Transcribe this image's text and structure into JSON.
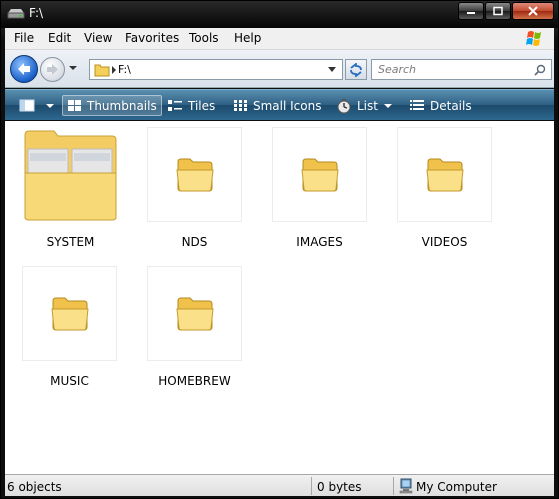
{
  "window": {
    "title": "F:\\"
  },
  "menu": {
    "items": [
      "File",
      "Edit",
      "View",
      "Favorites",
      "Tools",
      "Help"
    ]
  },
  "address": {
    "path": "F:\\"
  },
  "search": {
    "placeholder": "Search"
  },
  "toolbar": {
    "items": [
      {
        "label": "",
        "icon": "layout-icon"
      },
      {
        "label": "Thumbnails",
        "icon": "thumbnails-icon",
        "active": true
      },
      {
        "label": "Tiles",
        "icon": "tiles-icon"
      },
      {
        "label": "Small Icons",
        "icon": "small-icons-icon"
      },
      {
        "label": "List",
        "icon": "list-icon"
      },
      {
        "label": "Details",
        "icon": "details-icon"
      }
    ]
  },
  "folders": [
    {
      "name": "SYSTEM",
      "thumbnail": "open-folder-with-previews"
    },
    {
      "name": "NDS",
      "thumbnail": "folder-icon"
    },
    {
      "name": "IMAGES",
      "thumbnail": "folder-icon"
    },
    {
      "name": "VIDEOS",
      "thumbnail": "folder-icon"
    },
    {
      "name": "MUSIC",
      "thumbnail": "folder-icon"
    },
    {
      "name": "HOMEBREW",
      "thumbnail": "folder-icon"
    }
  ],
  "status": {
    "objects": "6 objects",
    "size": "0 bytes",
    "location": "My Computer"
  },
  "colors": {
    "toolbar": "#2d5f82",
    "folder": "#f6d873",
    "titlebar": "#0a0a0a"
  }
}
